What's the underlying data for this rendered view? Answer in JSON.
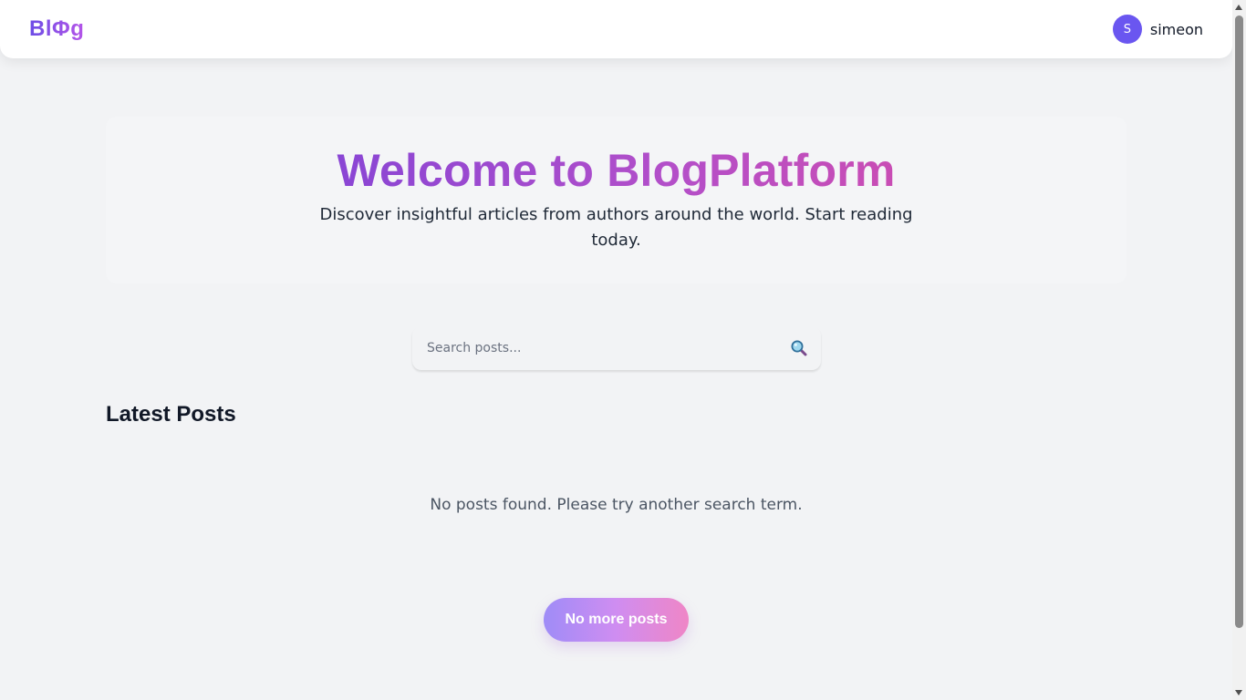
{
  "header": {
    "logo": "BlΦg",
    "user": {
      "avatar_initial": "S",
      "name": "simeon"
    }
  },
  "hero": {
    "title": "Welcome to BlogPlatform",
    "subtitle": "Discover insightful articles from authors around the world. Start reading today."
  },
  "search": {
    "placeholder": "Search posts...",
    "value": "",
    "icon": "magnifier-icon"
  },
  "posts": {
    "section_title": "Latest Posts",
    "empty_message": "No posts found. Please try another search term.",
    "items": []
  },
  "pagination": {
    "button_label": "No more posts"
  },
  "colors": {
    "background": "#f2f3f5",
    "header_bg": "#ffffff",
    "avatar_bg": "#6a56f0",
    "brand_purple": "#6d3fdc",
    "brand_pink": "#df4a9f"
  }
}
